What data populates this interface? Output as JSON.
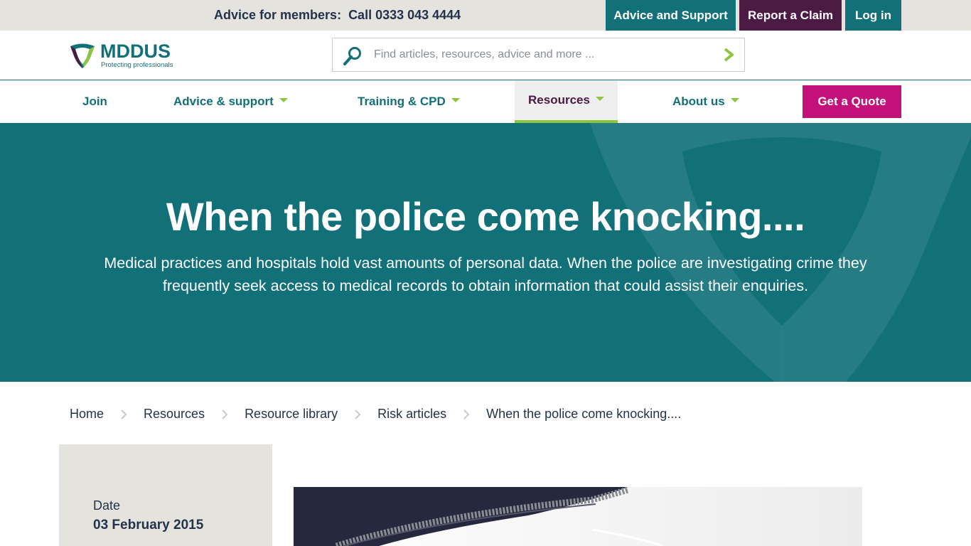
{
  "utility": {
    "advice_label": "Advice for members:",
    "phone": "Call 0333 043 4444",
    "advice_support": "Advice and Support",
    "report_claim": "Report a Claim",
    "login": "Log in"
  },
  "logo": {
    "name": "MDDUS",
    "tagline": "Protecting professionals"
  },
  "search": {
    "placeholder": "Find articles, resources, advice and more ...",
    "icon": "search-icon",
    "submit_icon": "chevron-right-icon"
  },
  "nav": {
    "join": "Join",
    "advice": "Advice & support",
    "training": "Training & CPD",
    "resources": "Resources",
    "about": "About us",
    "quote": "Get a Quote"
  },
  "hero": {
    "title": "When the police come knocking....",
    "subtitle": "Medical practices and hospitals hold vast amounts of personal data. When the police are investigating crime they frequently seek access to medical records to obtain information that could assist their enquiries."
  },
  "breadcrumb": [
    "Home",
    "Resources",
    "Resource library",
    "Risk articles",
    "When the police come knocking...."
  ],
  "info": {
    "date_label": "Date",
    "date_value": "03 February 2015"
  },
  "colors": {
    "teal": "#127079",
    "purple": "#4b1a45",
    "magenta": "#c2127a",
    "green": "#8cc63f",
    "navy": "#24324b",
    "grey": "#e4e3de"
  }
}
